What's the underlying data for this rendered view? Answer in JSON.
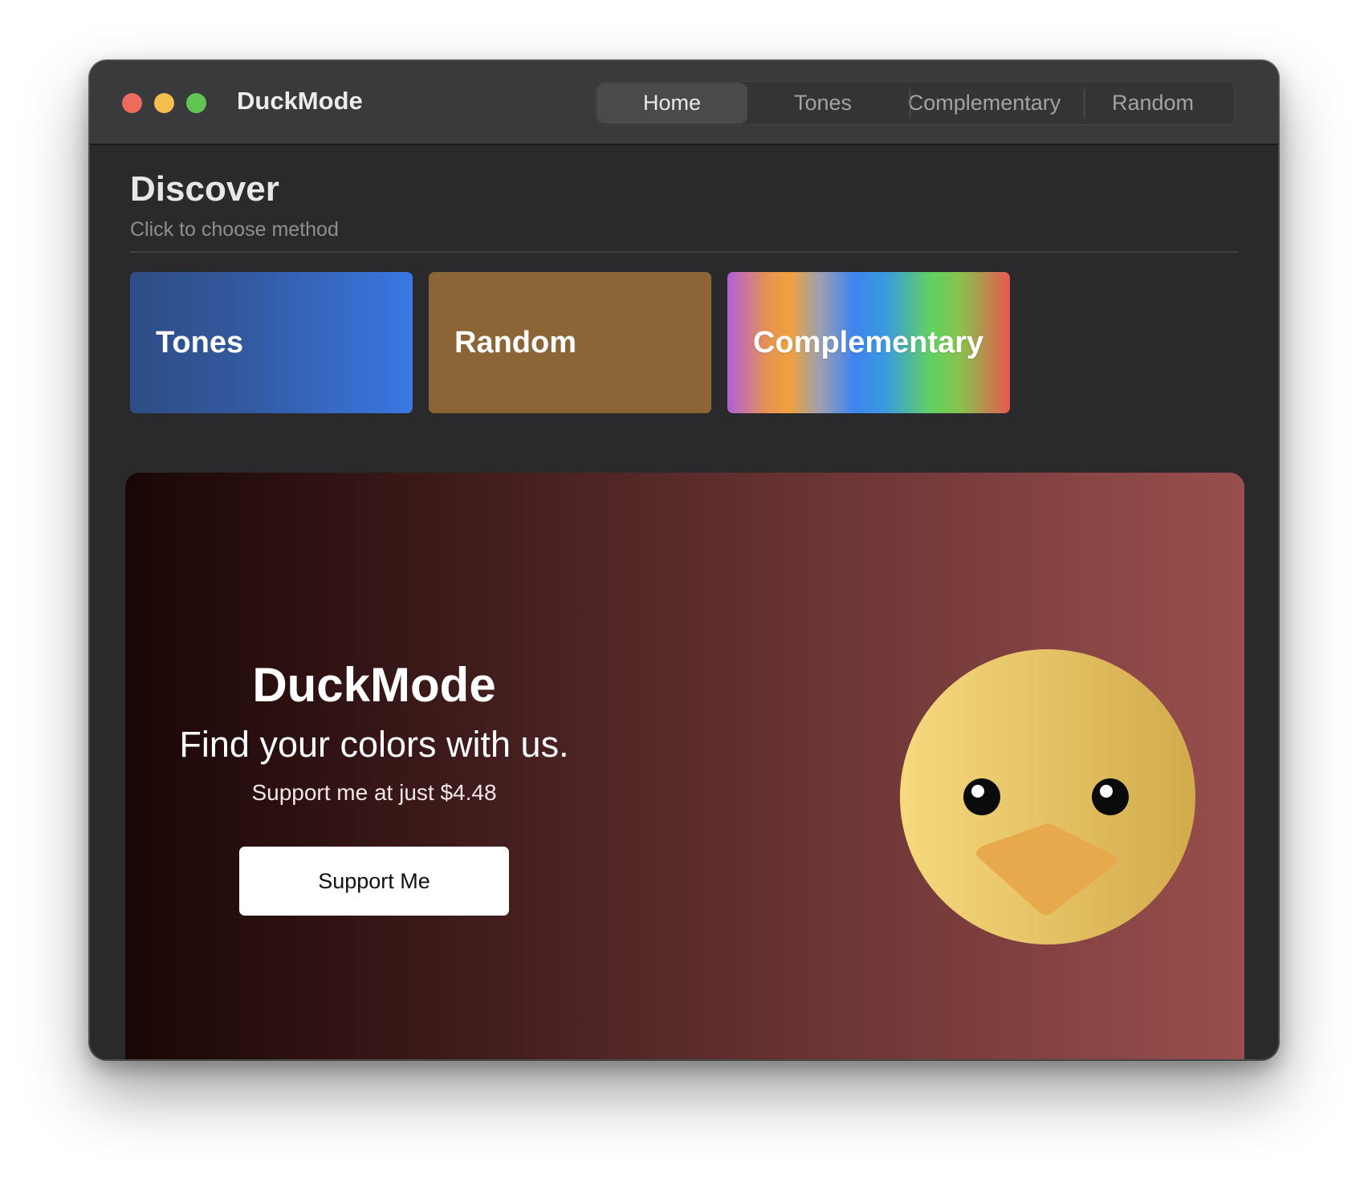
{
  "window": {
    "title": "DuckMode"
  },
  "nav": {
    "tabs": [
      {
        "label": "Home",
        "active": true
      },
      {
        "label": "Tones",
        "active": false
      },
      {
        "label": "Complementary",
        "active": false
      },
      {
        "label": "Random",
        "active": false
      }
    ]
  },
  "discover": {
    "title": "Discover",
    "subtitle": "Click to choose method",
    "cards": [
      {
        "label": "Tones",
        "color": "#3a78e4"
      },
      {
        "label": "Random",
        "color": "#8b6535"
      },
      {
        "label": "Complementary",
        "color": "gradient"
      }
    ]
  },
  "hero": {
    "title": "DuckMode",
    "tagline": "Find your colors with us.",
    "price_text": "Support me at just $4.48",
    "button_label": "Support Me",
    "mascot_icon": "duck-face-icon"
  },
  "colors": {
    "window_bg": "#2a292b",
    "titlebar_bg": "#3a393b",
    "close": "#ec6a5e",
    "minimize": "#f4bf4f",
    "maximize": "#61c554",
    "hero_start": "#1a0606",
    "hero_end": "#984f4d",
    "duck_yellow": "#f5d37b",
    "duck_beak": "#e8a94c"
  }
}
